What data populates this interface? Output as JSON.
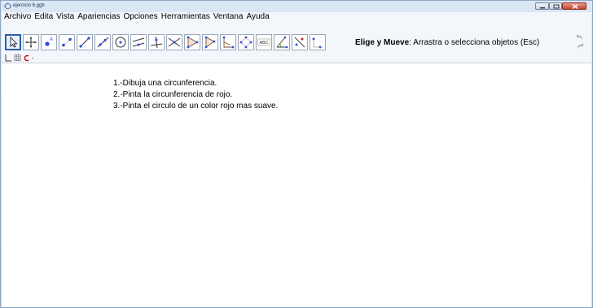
{
  "window": {
    "title": "ejercicio 6.ggb"
  },
  "menubar": {
    "items": [
      "Archivo",
      "Edita",
      "Vista",
      "Apariencias",
      "Opciones",
      "Herramientas",
      "Ventana",
      "Ayuda"
    ]
  },
  "toolbar": {
    "tools": [
      {
        "icon": "move-arrow-icon"
      },
      {
        "icon": "move-view-icon"
      },
      {
        "icon": "point-icon"
      },
      {
        "icon": "point-on-object-icon"
      },
      {
        "icon": "segment-icon"
      },
      {
        "icon": "ray-icon"
      },
      {
        "icon": "circle-icon"
      },
      {
        "icon": "parallel-line-icon"
      },
      {
        "icon": "perpendicular-line-icon"
      },
      {
        "icon": "intersect-icon"
      },
      {
        "icon": "polygon-icon"
      },
      {
        "icon": "regular-polygon-icon"
      },
      {
        "icon": "angle-icon"
      },
      {
        "icon": "transform-icon"
      },
      {
        "icon": "text-icon",
        "label": "ABC"
      },
      {
        "icon": "angle-measure-icon"
      },
      {
        "icon": "reflect-icon"
      },
      {
        "icon": "slider-icon"
      }
    ],
    "description_bold": "Elige y Mueve",
    "description_rest": ": Arrastra o selecciona objetos (Esc)"
  },
  "graphics": {
    "instructions": [
      "1.-Dibuja una circunferencia.",
      "2.-Pinta la circunferencia de rojo.",
      "3.-Pinta el circulo de un color rojo mas suave."
    ]
  },
  "colors": {
    "accent": "#2c5fa8",
    "point_blue": "#2b4fd8",
    "stylebar_red": "#cc0000"
  }
}
